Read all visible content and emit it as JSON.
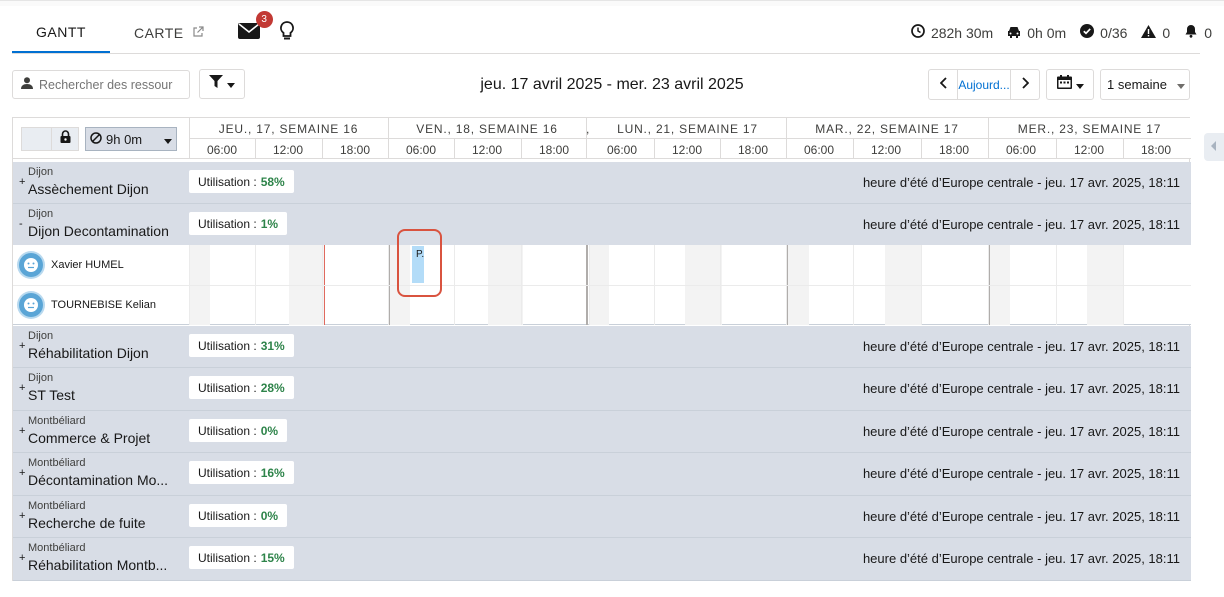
{
  "tabs": [
    {
      "label": "GANTT",
      "active": true
    },
    {
      "label": "CARTE",
      "active": false
    }
  ],
  "mail": {
    "badge": "3"
  },
  "stats": {
    "hours": "282h 30m",
    "travel": "0h 0m",
    "done": "0/36",
    "alerts": "0",
    "notifications": "0"
  },
  "toolbar": {
    "search_placeholder": "Rechercher des ressour",
    "date_range": "jeu. 17 avril 2025 - mer. 23 avril 2025",
    "today_label": "Aujourd...",
    "view_select": "1 semaine"
  },
  "header": {
    "hours_value": "9h 0m",
    "days": [
      {
        "label": "JEU., 17, SEMAINE 16"
      },
      {
        "label": "VEN., 18, SEMAINE 16"
      },
      {
        "label": ","
      },
      {
        "label": "LUN., 21, SEMAINE 17"
      },
      {
        "label": "MAR., 22, SEMAINE 17"
      },
      {
        "label": "MER., 23, SEMAINE 17"
      }
    ],
    "hours": [
      "06:00",
      "12:00",
      "18:00",
      "06:00",
      "12:00",
      "18:00",
      "06:00",
      "12:00",
      "18:00",
      "06:00",
      "12:00",
      "18:00",
      "06:00",
      "12:00",
      "18:00"
    ]
  },
  "groups": [
    {
      "toggle": "+",
      "parent": "Dijon",
      "name": "Assèchement Dijon",
      "util_label": "Utilisation :",
      "util_value": "58%",
      "tz": "heure d’été d’Europe centrale - jeu. 17 avr. 2025, 18:11"
    },
    {
      "toggle": "-",
      "parent": "Dijon",
      "name": "Dijon Decontamination",
      "util_label": "Utilisation :",
      "util_value": "1%",
      "tz": "heure d’été d’Europe centrale - jeu. 17 avr. 2025, 18:11"
    },
    {
      "toggle": "+",
      "parent": "Dijon",
      "name": "Réhabilitation Dijon",
      "util_label": "Utilisation :",
      "util_value": "31%",
      "tz": "heure d’été d’Europe centrale - jeu. 17 avr. 2025, 18:11"
    },
    {
      "toggle": "+",
      "parent": "Dijon",
      "name": "ST Test",
      "util_label": "Utilisation :",
      "util_value": "28%",
      "tz": "heure d’été d’Europe centrale - jeu. 17 avr. 2025, 18:11"
    },
    {
      "toggle": "+",
      "parent": "Montbéliard",
      "name": "Commerce & Projet",
      "util_label": "Utilisation :",
      "util_value": "0%",
      "tz": "heure d’été d’Europe centrale - jeu. 17 avr. 2025, 18:11"
    },
    {
      "toggle": "+",
      "parent": "Montbéliard",
      "name": "Décontamination Mo...",
      "util_label": "Utilisation :",
      "util_value": "16%",
      "tz": "heure d’été d’Europe centrale - jeu. 17 avr. 2025, 18:11"
    },
    {
      "toggle": "+",
      "parent": "Montbéliard",
      "name": "Recherche de fuite",
      "util_label": "Utilisation :",
      "util_value": "0%",
      "tz": "heure d’été d’Europe centrale - jeu. 17 avr. 2025, 18:11"
    },
    {
      "toggle": "+",
      "parent": "Montbéliard",
      "name": "Réhabilitation Montb...",
      "util_label": "Utilisation :",
      "util_value": "15%",
      "tz": "heure d’été d’Europe centrale - jeu. 17 avr. 2025, 18:11"
    }
  ],
  "resources": [
    {
      "name": "Xavier HUMEL"
    },
    {
      "name": "TOURNEBISE Kelian"
    }
  ],
  "task": {
    "label": "P."
  }
}
